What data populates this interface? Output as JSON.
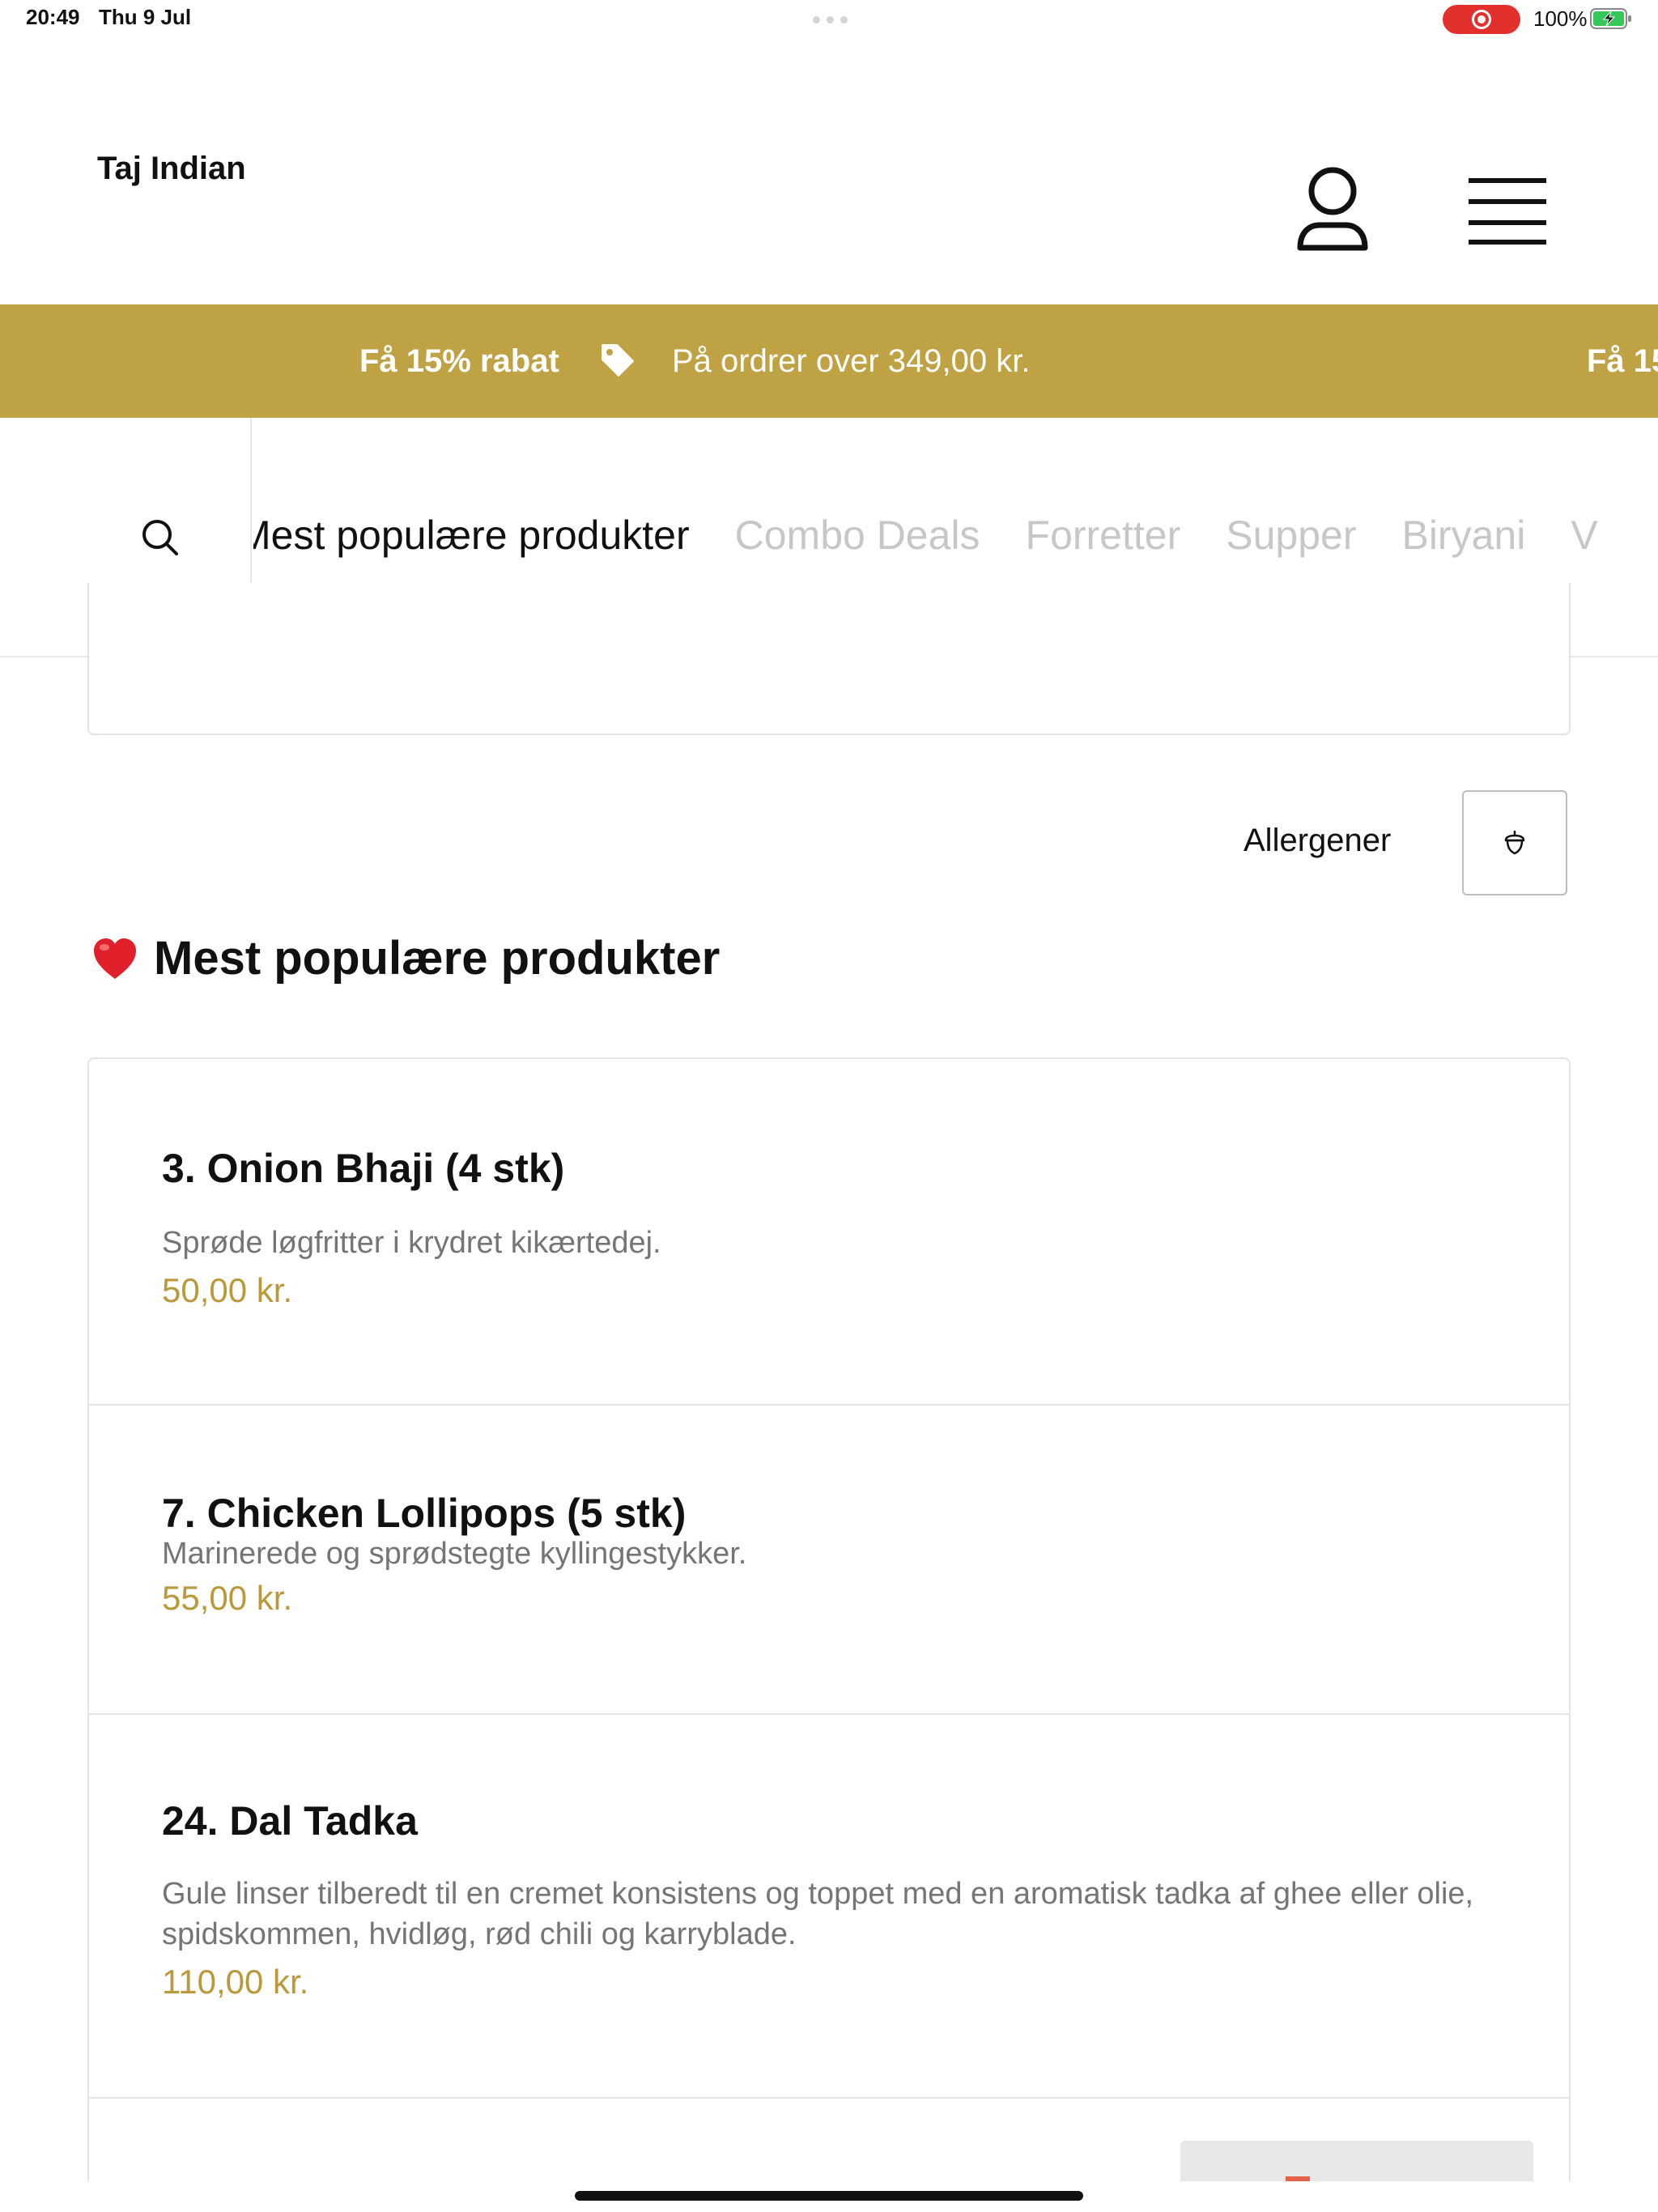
{
  "status_bar": {
    "time": "20:49",
    "date": "Thu 9 Jul",
    "battery_percent": "100%"
  },
  "header": {
    "brand": "Taj Indian",
    "icons": {
      "account": "user-icon",
      "menu": "hamburger-menu-icon"
    }
  },
  "promo": {
    "bold": "Få 15% rabat",
    "text": "På ordrer over 349,00 kr.",
    "repeat": "Få 15",
    "icon": "tag-icon"
  },
  "categories": {
    "items": [
      {
        "label": "Mest populære produkter",
        "active": true
      },
      {
        "label": "Combo Deals",
        "active": false
      },
      {
        "label": "Forretter",
        "active": false
      },
      {
        "label": "Supper",
        "active": false
      },
      {
        "label": "Biryani",
        "active": false
      },
      {
        "label": "V",
        "active": false
      }
    ]
  },
  "allergens": {
    "label": "Allergener",
    "icon": "acorn-icon"
  },
  "section": {
    "emoji_icon": "heart-icon",
    "title": "Mest populære produkter"
  },
  "products": [
    {
      "name": "3. Onion Bhaji (4 stk)",
      "description": "Sprøde løgfritter i krydret kikærtedej.",
      "price": "50,00 kr."
    },
    {
      "name": "7. Chicken Lollipops (5 stk)",
      "description": "Marinerede og sprødstegte kyllingestykker.",
      "price": "55,00 kr."
    },
    {
      "name": "24. Dal Tadka",
      "description": "Gule linser tilberedt til en cremet konsistens og toppet med en aromatisk tadka af ghee eller olie, spidskommen, hvidløg, rød chili og karryblade.",
      "price": "110,00 kr."
    }
  ],
  "colors": {
    "accent": "#bfa244",
    "price": "#b9993a",
    "record": "#e2302c",
    "inactive_category": "#c7c7c7"
  }
}
